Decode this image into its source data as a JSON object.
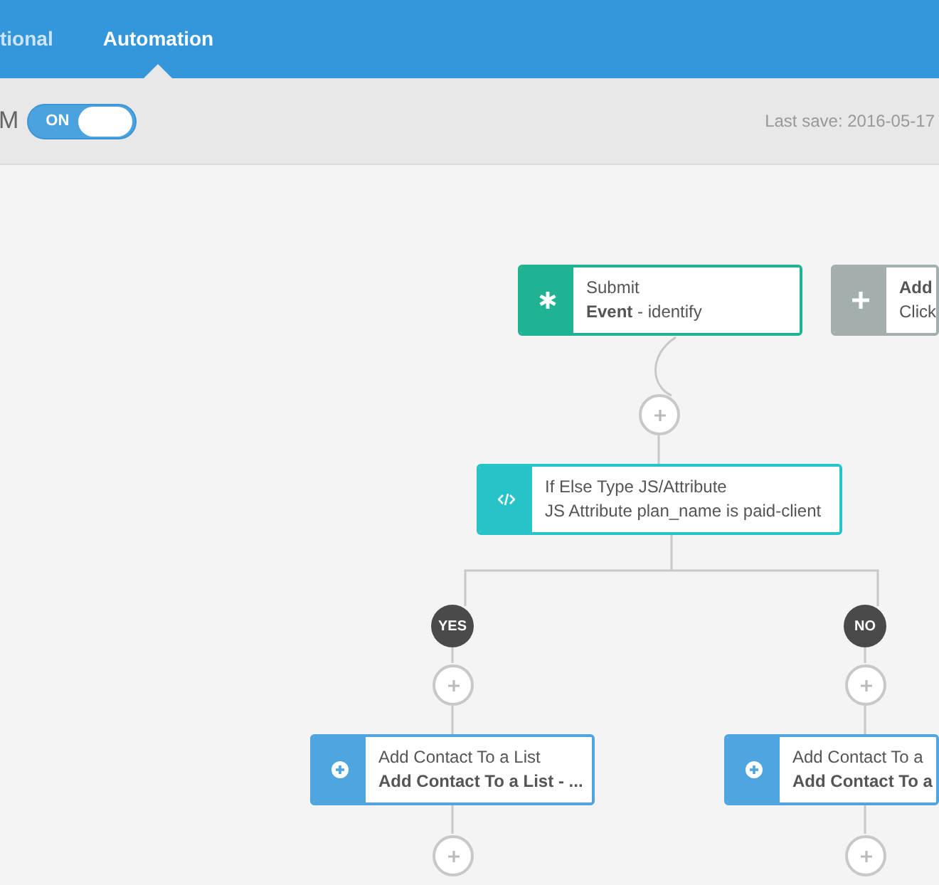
{
  "tabs": [
    {
      "label": "tional",
      "selected": false
    },
    {
      "label": "Automation",
      "selected": true
    }
  ],
  "toolbar": {
    "name": "M",
    "toggle": {
      "label": "ON",
      "on": true
    },
    "last_save": "Last save: 2016-05-17"
  },
  "nodes": [
    {
      "kind": "event",
      "title": "Submit",
      "subtitle": "**Event** - identify"
    },
    {
      "kind": "placeholder",
      "title": "Add",
      "subtitle": "Click"
    },
    {
      "kind": "condition",
      "title": "If Else Type JS/Attribute",
      "subtitle": "JS Attribute plan_name is paid-client"
    },
    {
      "kind": "action",
      "title": "Add Contact To a List",
      "subtitle": "Add Contact To a List - ..."
    },
    {
      "kind": "action",
      "title": "Add Contact To a",
      "subtitle": "Add Contact To a"
    }
  ],
  "branches": [
    {
      "label": "YES"
    },
    {
      "label": "NO"
    }
  ]
}
